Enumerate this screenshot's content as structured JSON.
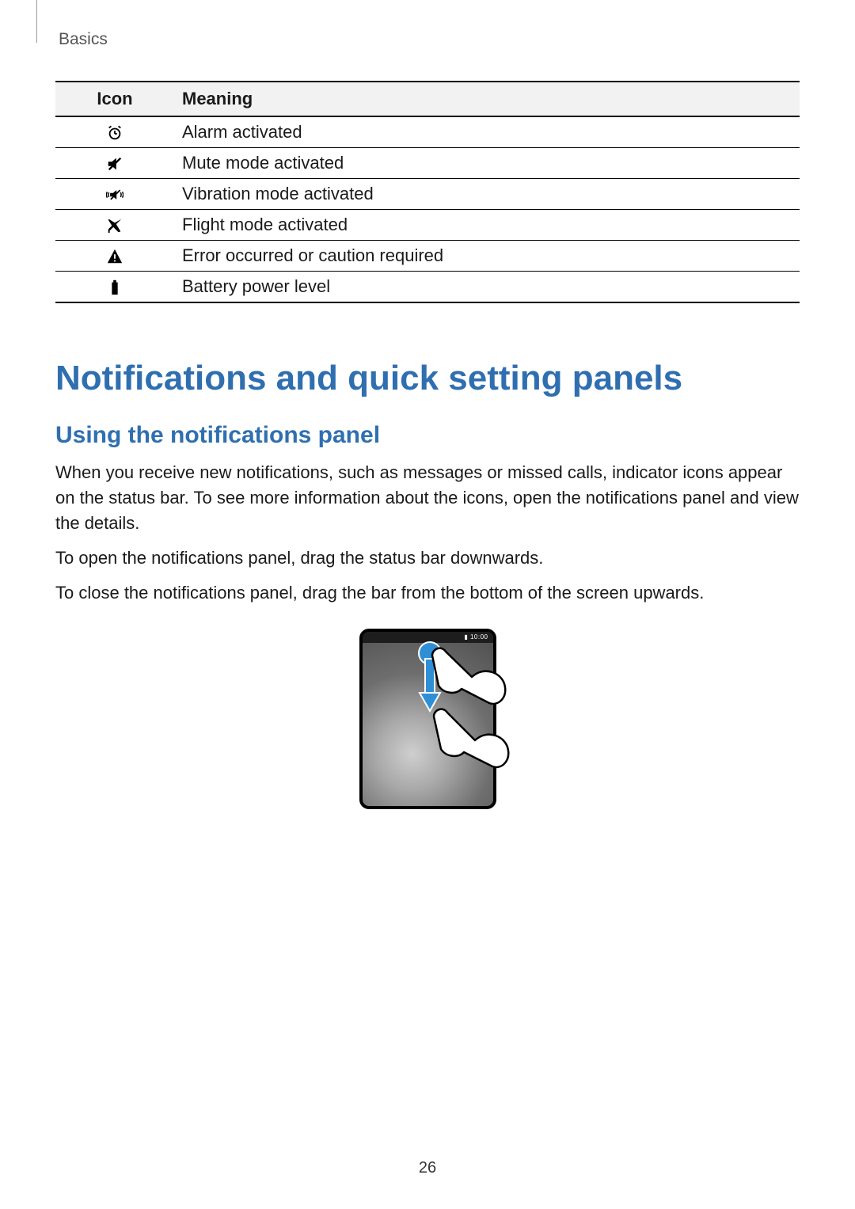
{
  "header": {
    "section": "Basics"
  },
  "table": {
    "head": {
      "icon": "Icon",
      "meaning": "Meaning"
    },
    "rows": [
      {
        "icon": "alarm-icon",
        "meaning": "Alarm activated"
      },
      {
        "icon": "mute-icon",
        "meaning": "Mute mode activated"
      },
      {
        "icon": "vibration-icon",
        "meaning": "Vibration mode activated"
      },
      {
        "icon": "flight-icon",
        "meaning": "Flight mode activated"
      },
      {
        "icon": "error-icon",
        "meaning": "Error occurred or caution required"
      },
      {
        "icon": "battery-icon",
        "meaning": "Battery power level"
      }
    ]
  },
  "headings": {
    "main": "Notifications and quick setting panels",
    "sub": "Using the notifications panel"
  },
  "paragraphs": {
    "p1": "When you receive new notifications, such as messages or missed calls, indicator icons appear on the status bar. To see more information about the icons, open the notifications panel and view the details.",
    "p2": "To open the notifications panel, drag the status bar downwards.",
    "p3": "To close the notifications panel, drag the bar from the bottom of the screen upwards."
  },
  "pagenum": "26"
}
